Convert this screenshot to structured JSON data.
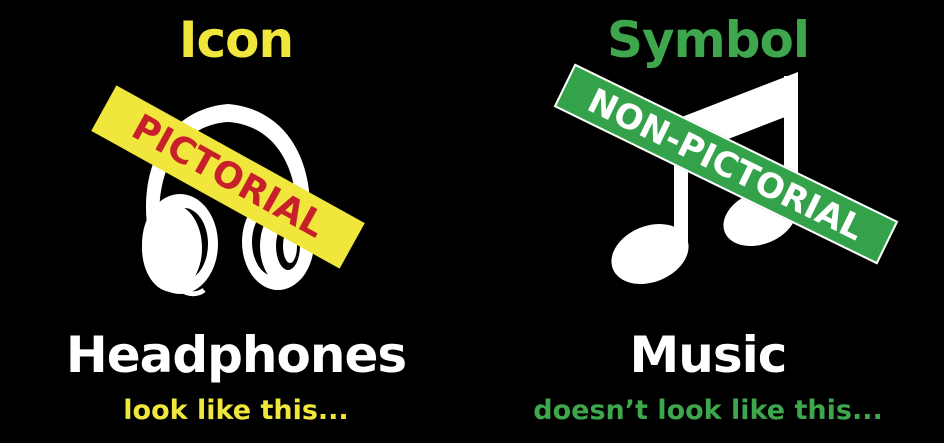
{
  "left": {
    "heading": "Icon",
    "banner": "PICTORIAL",
    "name": "Headphones",
    "caption": "look like this...",
    "heading_color": "#f0e63c",
    "caption_color": "#f0e63c",
    "banner_bg": "#f0e63c",
    "banner_text_color": "#c8202a",
    "art_icon": "headphones-icon"
  },
  "right": {
    "heading": "Symbol",
    "banner": "NON-PICTORIAL",
    "name": "Music",
    "caption": "doesn’t look like this...",
    "heading_color": "#3ea64c",
    "caption_color": "#3ea64c",
    "banner_bg": "#34a24a",
    "banner_text_color": "#ffffff",
    "art_icon": "music-note-icon"
  },
  "background": "#000000"
}
